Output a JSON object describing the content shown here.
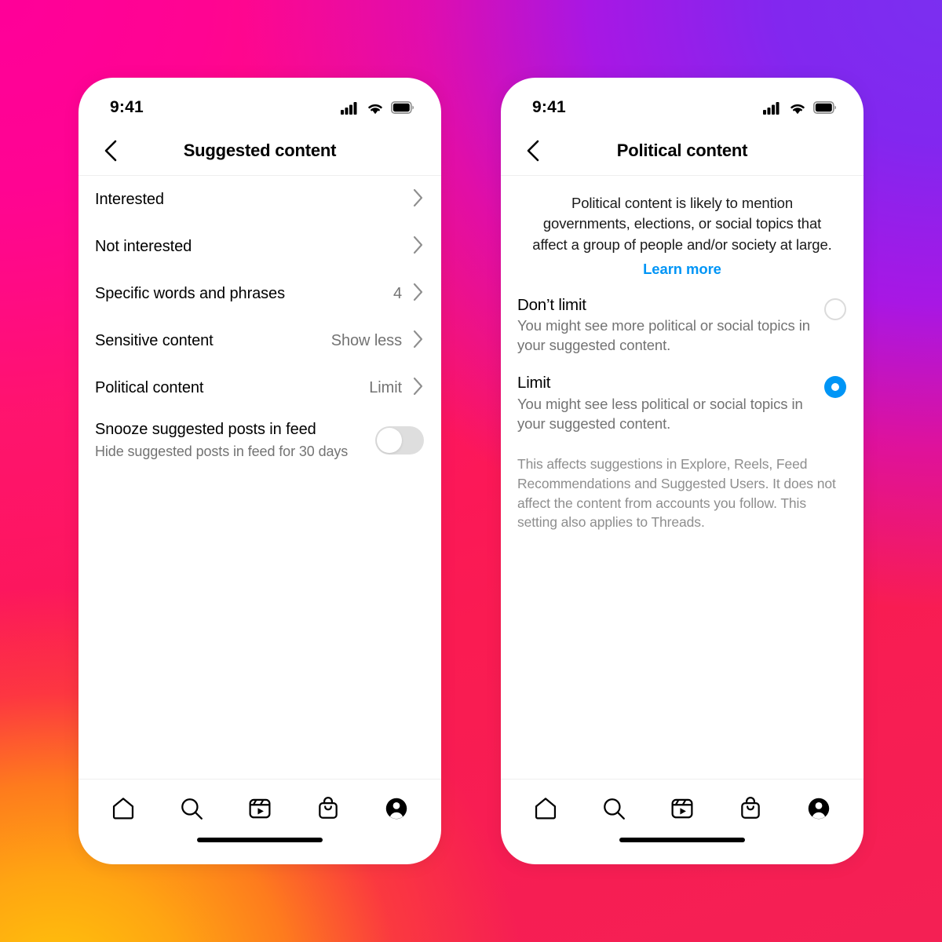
{
  "background": {
    "gradient_colors": [
      "#FF0099",
      "#7B2FF0",
      "#BB0FDD",
      "#FA1B52",
      "#FA2B40",
      "#FFC40A"
    ]
  },
  "accent": {
    "blue": "#0095F6",
    "muted_text": "#737373",
    "footnote_text": "#8e8e8e",
    "toggle_track_off": "#dedede",
    "radio_ring": "#dbdbdb"
  },
  "status_bar": {
    "time": "9:41",
    "cellular_icon": "cellular-signal-icon",
    "wifi_icon": "wifi-icon",
    "battery_icon": "battery-full-icon"
  },
  "screen_left": {
    "back_icon": "chevron-left-icon",
    "title": "Suggested content",
    "rows": [
      {
        "label": "Interested",
        "value": "",
        "chevron": "chevron-right-icon"
      },
      {
        "label": "Not interested",
        "value": "",
        "chevron": "chevron-right-icon"
      },
      {
        "label": "Specific words and phrases",
        "value": "4",
        "chevron": "chevron-right-icon"
      },
      {
        "label": "Sensitive content",
        "value": "Show less",
        "chevron": "chevron-right-icon"
      },
      {
        "label": "Political content",
        "value": "Limit",
        "chevron": "chevron-right-icon"
      }
    ],
    "toggle_row": {
      "title": "Snooze suggested posts in feed",
      "subtitle": "Hide suggested posts in feed for 30 days",
      "state": "off"
    }
  },
  "screen_right": {
    "back_icon": "chevron-left-icon",
    "title": "Political content",
    "intro": "Political content is likely to mention governments, elections, or social topics that affect a group of people and/or society at large.",
    "learn_more": "Learn more",
    "options": [
      {
        "title": "Don’t limit",
        "subtitle": "You might see more political or social topics in your suggested content.",
        "selected": false
      },
      {
        "title": "Limit",
        "subtitle": "You might see less political or social topics in your suggested content.",
        "selected": true
      }
    ],
    "footnote": "This affects suggestions in Explore, Reels, Feed Recommendations and Suggested Users. It does not affect the content from accounts you follow. This setting also applies to Threads."
  },
  "tab_bar": {
    "items": [
      {
        "icon": "home-icon",
        "label": "Home"
      },
      {
        "icon": "search-icon",
        "label": "Search"
      },
      {
        "icon": "reels-icon",
        "label": "Reels"
      },
      {
        "icon": "shop-icon",
        "label": "Shop"
      },
      {
        "icon": "profile-icon",
        "label": "Profile"
      }
    ]
  }
}
